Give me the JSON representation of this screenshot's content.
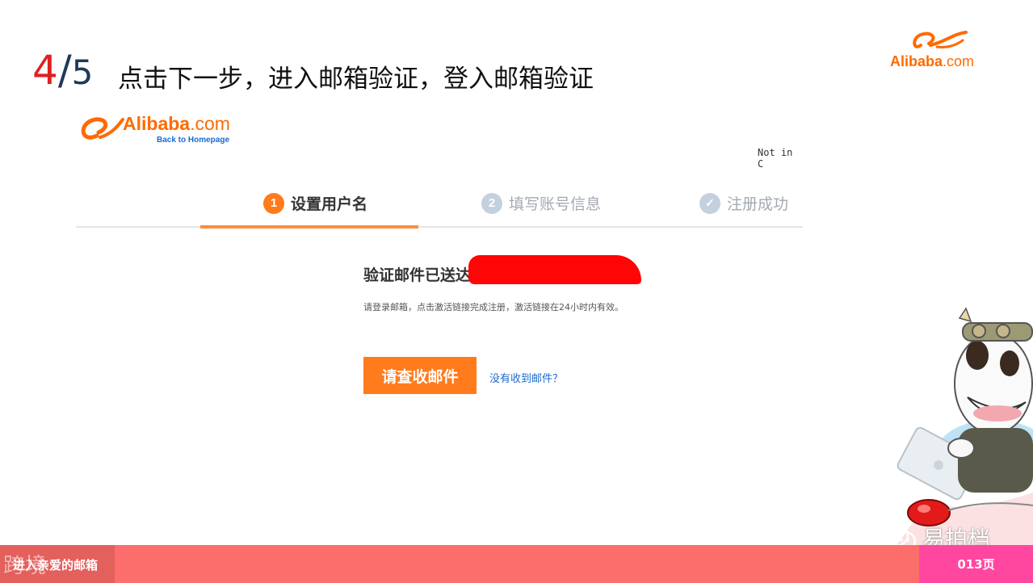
{
  "slide": {
    "step_current": "4",
    "step_separator": "/",
    "step_total": "5",
    "headline": "点击下一步，进入邮箱验证，登入邮箱验证",
    "corner_logo": {
      "brand": "Alibaba",
      "domain": ".com"
    }
  },
  "screenshot": {
    "logo": {
      "brand": "Alibaba",
      "domain": ".com",
      "back_link": "Back to Homepage"
    },
    "not_in": "Not in C",
    "steps": [
      {
        "badge": "1",
        "label": "设置用户名",
        "state": "active"
      },
      {
        "badge": "2",
        "label": "填写账号信息",
        "state": "pending"
      },
      {
        "badge": "✓",
        "label": "注册成功",
        "state": "pending"
      }
    ],
    "sent_message": "验证邮件已送达",
    "hint": "请登录邮箱，点击激活链接完成注册，激活链接在24小时内有效。",
    "check_mail_button": "请查收邮件",
    "not_received_link": "没有收到邮件？"
  },
  "footer": {
    "left_text": "进入亲爱的邮箱",
    "watermark": "跨境",
    "wechat_name": "易拍档",
    "page_label": "013页"
  },
  "colors": {
    "accent_orange": "#ff7a1a",
    "step_red": "#e02020",
    "footer_bar": "#fb6e6b",
    "page_box": "#ff47a0",
    "link_blue": "#1a6ad0"
  }
}
